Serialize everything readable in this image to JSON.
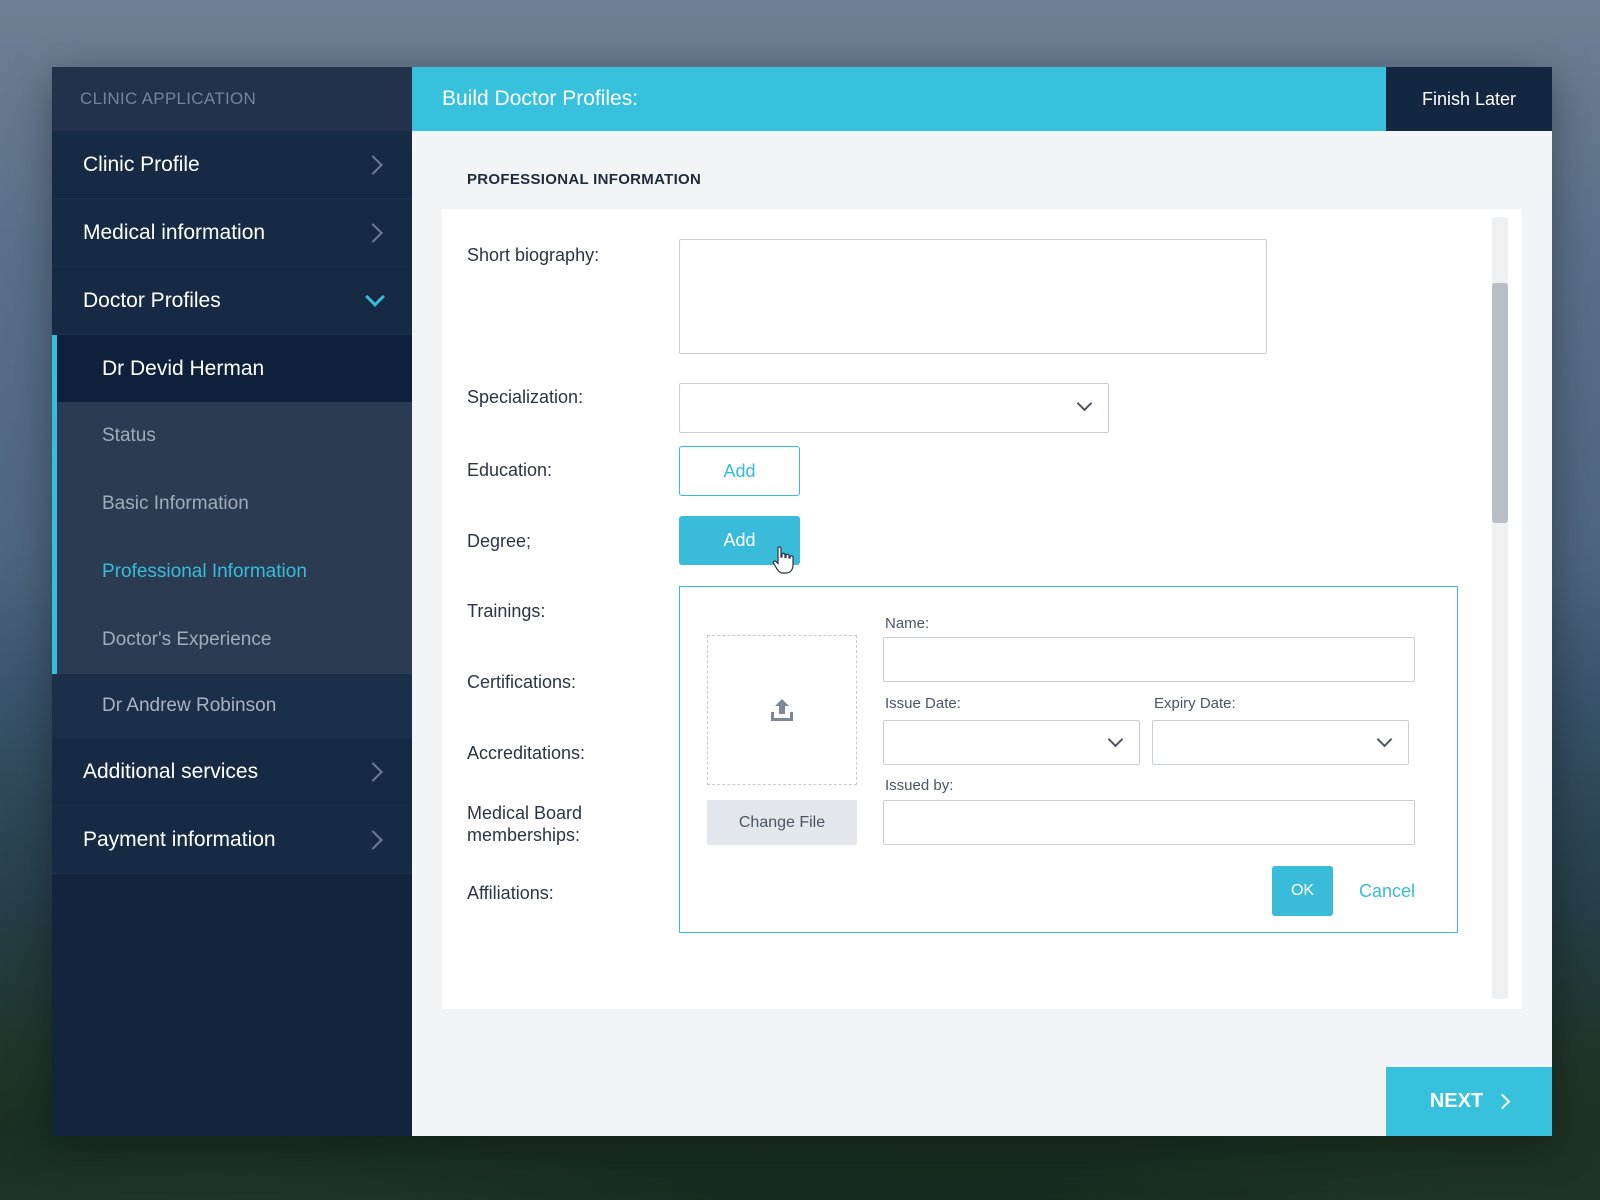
{
  "sidebar": {
    "app_title": "CLINIC APPLICATION",
    "clinic_profile": "Clinic Profile",
    "medical_information": "Medical information",
    "doctor_profiles": "Doctor Profiles",
    "doctors": {
      "active_doctor": "Dr Devid Herman",
      "sub_items": [
        "Status",
        "Basic Information",
        "Professional Information",
        "Doctor's Experience"
      ],
      "other_doctor": "Dr Andrew Robinson"
    },
    "additional_services": "Additional services",
    "payment_information": "Payment information"
  },
  "header": {
    "title": "Build Doctor Profiles:",
    "finish_later": "Finish Later"
  },
  "form": {
    "section_title": "PROFESSIONAL INFORMATION",
    "labels": {
      "short_biography": "Short biography:",
      "specialization": "Specialization:",
      "education": "Education:",
      "degree": "Degree;",
      "trainings": "Trainings:",
      "certifications": "Certifications:",
      "accreditations": "Accreditations:",
      "medical_board_1": "Medical Board",
      "medical_board_2": "memberships:",
      "affiliations": "Affiliations:"
    },
    "education_add": "Add",
    "degree_add": "Add",
    "panel": {
      "name_label": "Name:",
      "issue_date_label": "Issue Date:",
      "expiry_date_label": "Expiry Date:",
      "issued_by_label": "Issued by:",
      "change_file": "Change File",
      "ok": "OK",
      "cancel": "Cancel"
    }
  },
  "footer": {
    "next": "NEXT"
  },
  "colors": {
    "accent": "#38c1dc",
    "sidebar_bg": "#13253d",
    "dark_button": "#142740"
  }
}
